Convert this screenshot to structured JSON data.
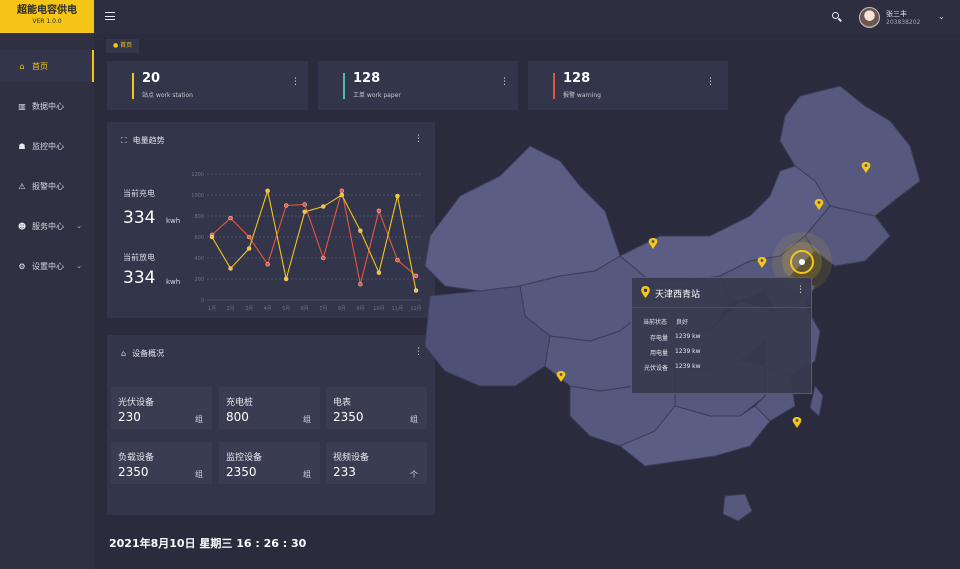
{
  "brand": {
    "title": "超能电容供电",
    "version": "VER 1.0.0"
  },
  "sidebar": {
    "items": [
      {
        "label": "首页",
        "icon": "home-icon",
        "glyph": "⌂",
        "active": true,
        "chevron": ""
      },
      {
        "label": "数据中心",
        "icon": "bar-chart-icon",
        "glyph": "▥",
        "active": false,
        "chevron": ""
      },
      {
        "label": "监控中心",
        "icon": "monitor-icon",
        "glyph": "☗",
        "active": false,
        "chevron": ""
      },
      {
        "label": "报警中心",
        "icon": "alarm-icon",
        "glyph": "⚠",
        "active": false,
        "chevron": ""
      },
      {
        "label": "服务中心",
        "icon": "users-icon",
        "glyph": "☻",
        "active": false,
        "chevron": "⌄"
      },
      {
        "label": "设置中心",
        "icon": "gear-icon",
        "glyph": "⚙",
        "active": false,
        "chevron": "⌄"
      }
    ]
  },
  "user": {
    "name": "张三丰",
    "id": "203838202"
  },
  "breadcrumb": "● 首页",
  "stats": [
    {
      "value": "20",
      "label": "站点  work station",
      "color": "#f5c518"
    },
    {
      "value": "128",
      "label": "工单  work paper",
      "color": "#4fbfa8"
    },
    {
      "value": "128",
      "label": "报警  warning",
      "color": "#e05548"
    }
  ],
  "trend": {
    "title": "电量趋势",
    "charge_label": "当前充电",
    "charge_value": "334",
    "charge_unit": "kwh",
    "discharge_label": "当前放电",
    "discharge_value": "334",
    "discharge_unit": "kwh"
  },
  "chart_data": {
    "type": "line",
    "categories": [
      "1月",
      "2月",
      "3月",
      "4月",
      "5月",
      "6月",
      "7月",
      "8月",
      "9月",
      "10月",
      "11月",
      "12月"
    ],
    "ylim": [
      0,
      1200
    ],
    "yticks": [
      0,
      200,
      400,
      600,
      800,
      1000,
      1200
    ],
    "grid": true,
    "series": [
      {
        "color": "#e8563f",
        "values": [
          620,
          780,
          600,
          340,
          900,
          910,
          400,
          1040,
          150,
          850,
          380,
          230
        ]
      },
      {
        "color": "#f5c518",
        "values": [
          600,
          300,
          490,
          1040,
          200,
          840,
          890,
          1000,
          660,
          260,
          990,
          90
        ]
      }
    ]
  },
  "devices": {
    "title": "设备概况",
    "items": [
      {
        "name": "光伏设备",
        "value": "230",
        "unit": "组"
      },
      {
        "name": "充电桩",
        "value": "800",
        "unit": "组"
      },
      {
        "name": "电表",
        "value": "2350",
        "unit": "组"
      },
      {
        "name": "负载设备",
        "value": "2350",
        "unit": "组"
      },
      {
        "name": "监控设备",
        "value": "2350",
        "unit": "组"
      },
      {
        "name": "视频设备",
        "value": "233",
        "unit": "个"
      }
    ]
  },
  "clock": "2021年8月10日 星期三   16 : 26 : 30",
  "popup": {
    "title": "天津西青站",
    "status_label": "当前状态",
    "status_value": "良好",
    "rows": [
      {
        "label": "存电量",
        "value": "1239 kw"
      },
      {
        "label": "用电量",
        "value": "1239 kw"
      },
      {
        "label": "光伏设备",
        "value": "1239 kw"
      }
    ]
  },
  "colors": {
    "accent": "#f5c518",
    "map_fill": "#56587e",
    "map_fill_dark": "#484a6c"
  }
}
